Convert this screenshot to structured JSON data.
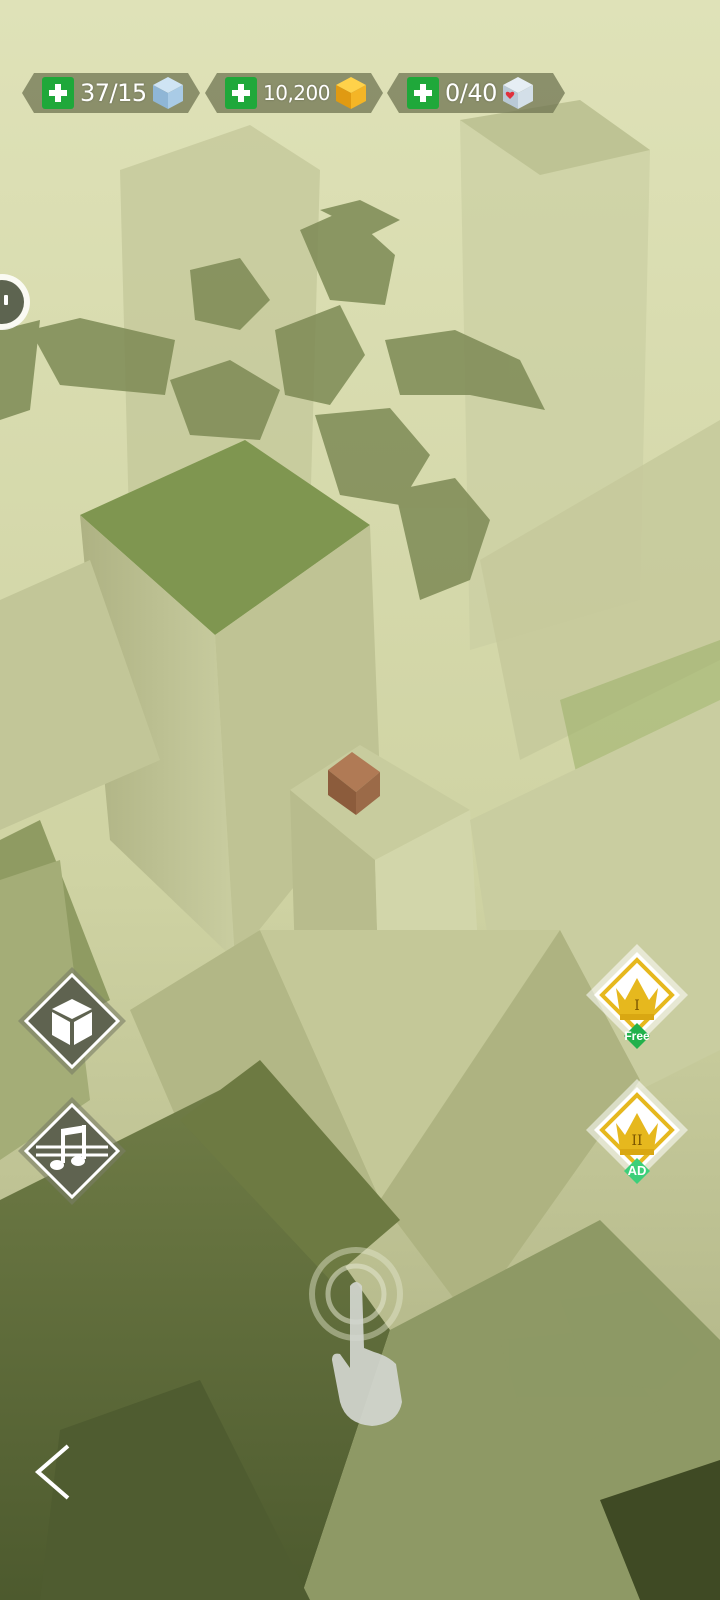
{
  "hud": {
    "blue_cubes": {
      "value": "37/15",
      "icon": "blue-cube-icon"
    },
    "gold": {
      "value": "10,200",
      "icon": "gold-cube-icon"
    },
    "heart_cubes": {
      "value": "0/40",
      "icon": "heart-cube-icon"
    },
    "plus_icon": "plus-icon"
  },
  "side_buttons": [
    {
      "name": "cube-skin-button",
      "icon": "cube-icon"
    },
    {
      "name": "music-button",
      "icon": "music-notes-icon"
    }
  ],
  "crowns": [
    {
      "name": "crown-level-1-button",
      "numeral": "I",
      "tag": "Free",
      "tag_color": "#22b14c"
    },
    {
      "name": "crown-level-2-button",
      "numeral": "II",
      "tag": "AD",
      "tag_color": "#3ccf7a"
    }
  ],
  "colors": {
    "fog": "#d9dcb0",
    "moss": "#7f9650",
    "pillar": "#b9be8c",
    "player_cube": "#9b6a48",
    "crown_gold": "#e6b81e"
  }
}
